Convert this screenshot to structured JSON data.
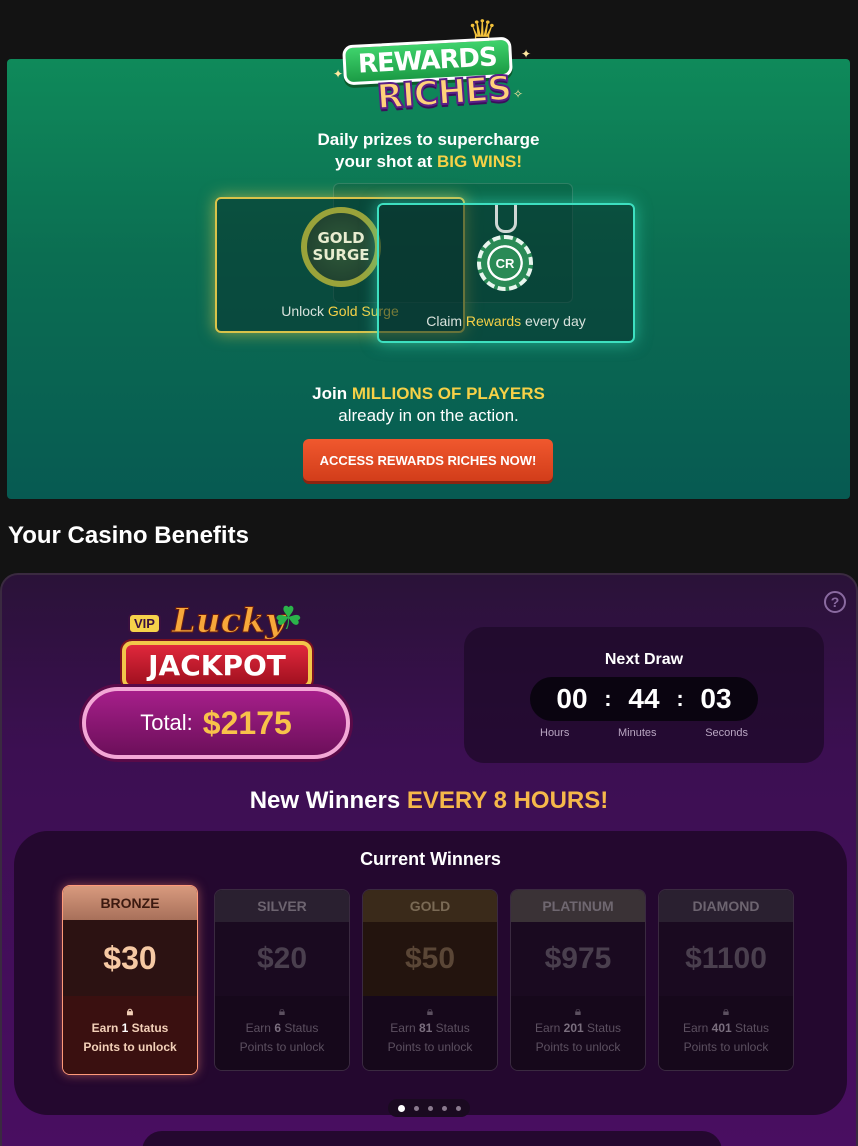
{
  "banner": {
    "logo_line1": "REWARDS",
    "logo_line2": "RICHES",
    "tagline_line1": "Daily prizes to supercharge",
    "tagline_line2_prefix": "your shot at ",
    "tagline_line2_highlight": "BIG WINS!",
    "card_gold": {
      "badge_line1": "GOLD",
      "badge_line2": "SURGE",
      "label_prefix": "Unlock ",
      "label_highlight": "Gold Surge"
    },
    "card_claim": {
      "chip_text": "CR",
      "label_prefix": "Claim ",
      "label_highlight": "Rewards",
      "label_suffix": " every day"
    },
    "join_prefix": "Join ",
    "join_highlight": "MILLIONS OF PLAYERS",
    "join_line2": "already in on the action.",
    "cta_label": "ACCESS REWARDS RICHES NOW!"
  },
  "section_title": "Your Casino Benefits",
  "jackpot": {
    "vip": "VIP",
    "lucky": "Lucky",
    "jackpot": "JACKPOT",
    "total_label": "Total:",
    "total_value": "$2175"
  },
  "draw": {
    "title": "Next Draw",
    "hours": "00",
    "minutes": "44",
    "seconds": "03",
    "hours_label": "Hours",
    "minutes_label": "Minutes",
    "seconds_label": "Seconds"
  },
  "winners": {
    "headline_prefix": "New Winners ",
    "headline_highlight": "EVERY 8 HOURS!",
    "title": "Current Winners",
    "tiers": [
      {
        "name": "BRONZE",
        "amount": "$30",
        "req_prefix": "Earn ",
        "req_points": "1",
        "req_suffix": " Status",
        "req_line2": "Points to unlock"
      },
      {
        "name": "SILVER",
        "amount": "$20",
        "req_prefix": "Earn ",
        "req_points": "6",
        "req_suffix": " Status",
        "req_line2": "Points to unlock"
      },
      {
        "name": "GOLD",
        "amount": "$50",
        "req_prefix": "Earn ",
        "req_points": "81",
        "req_suffix": " Status",
        "req_line2": "Points to unlock"
      },
      {
        "name": "PLATINUM",
        "amount": "$975",
        "req_prefix": "Earn ",
        "req_points": "201",
        "req_suffix": " Status",
        "req_line2": "Points to unlock"
      },
      {
        "name": "DIAMOND",
        "amount": "$1100",
        "req_prefix": "Earn ",
        "req_points": "401",
        "req_suffix": " Status",
        "req_line2": "Points to unlock"
      }
    ],
    "active_page": 1,
    "page_count": 5
  },
  "icons": {
    "help": "question-circle-icon",
    "lock": "lock-icon",
    "crown": "crown-icon",
    "clover": "clover-icon"
  },
  "colors": {
    "banner_green": "#0f8a5a",
    "highlight_yellow": "#f6d147",
    "cta_orange": "#f0582e",
    "panel_purple": "#4a0e62",
    "jackpot_gold": "#f8c24a"
  }
}
